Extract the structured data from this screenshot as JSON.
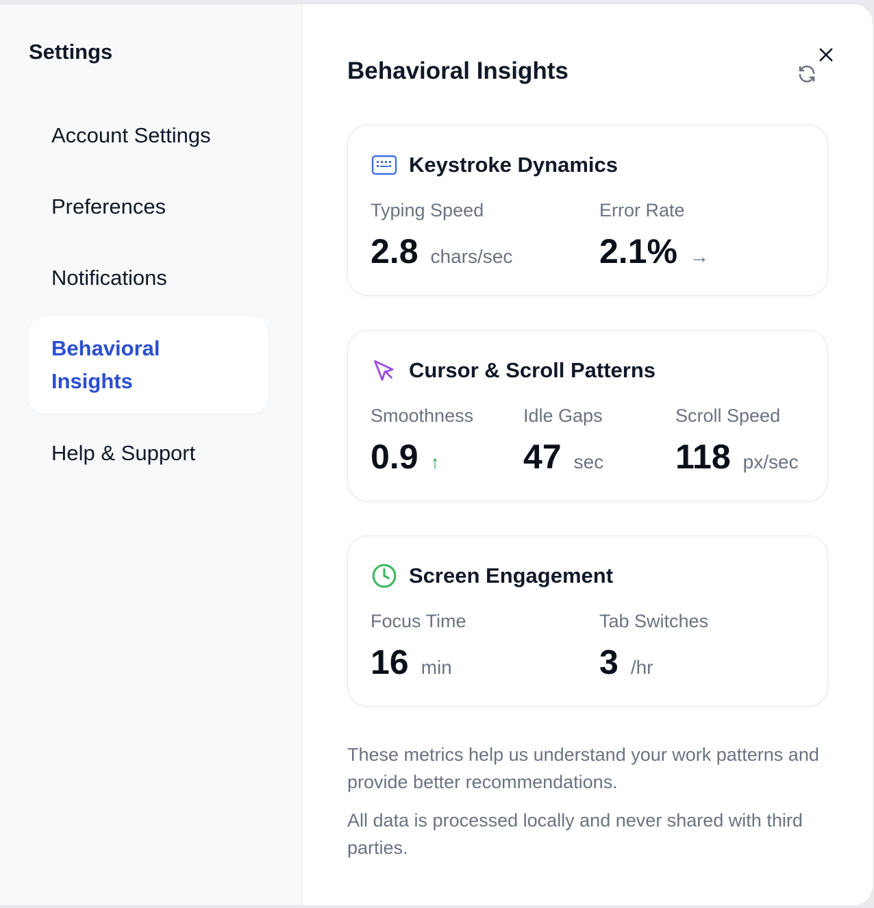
{
  "sidebar": {
    "title": "Settings",
    "items": [
      {
        "label": "Account Settings"
      },
      {
        "label": "Preferences"
      },
      {
        "label": "Notifications"
      },
      {
        "label": "Behavioral Insights",
        "active": true
      },
      {
        "label": "Help & Support"
      }
    ]
  },
  "main": {
    "title": "Behavioral Insights",
    "refresh_icon": "refresh-icon",
    "close_icon": "close-icon"
  },
  "cards": {
    "keystroke": {
      "title": "Keystroke Dynamics",
      "icon": "keyboard-icon",
      "icon_color": "#3b6fe0",
      "metrics": [
        {
          "label": "Typing Speed",
          "value": "2.8",
          "unit": "chars/sec"
        },
        {
          "label": "Error Rate",
          "value": "2.1%",
          "trend": "→"
        }
      ]
    },
    "cursor": {
      "title": "Cursor & Scroll Patterns",
      "icon": "cursor-icon",
      "icon_color": "#9b4de0",
      "metrics": [
        {
          "label": "Smoothness",
          "value": "0.9",
          "trend": "↑"
        },
        {
          "label": "Idle Gaps",
          "value": "47",
          "unit": "sec"
        },
        {
          "label": "Scroll Speed",
          "value": "118",
          "unit": "px/sec"
        }
      ]
    },
    "engagement": {
      "title": "Screen Engagement",
      "icon": "clock-icon",
      "icon_color": "#3fb860",
      "metrics": [
        {
          "label": "Focus Time",
          "value": "16",
          "unit": "min"
        },
        {
          "label": "Tab Switches",
          "value": "3",
          "unit": "/hr"
        }
      ]
    }
  },
  "footer": {
    "line1": "These metrics help us understand your work patterns and provide better recommendations.",
    "line2": "All data is processed locally and never shared with third parties."
  },
  "colors": {
    "accent": "#2b4fd0",
    "trend_up": "#22a84a"
  }
}
